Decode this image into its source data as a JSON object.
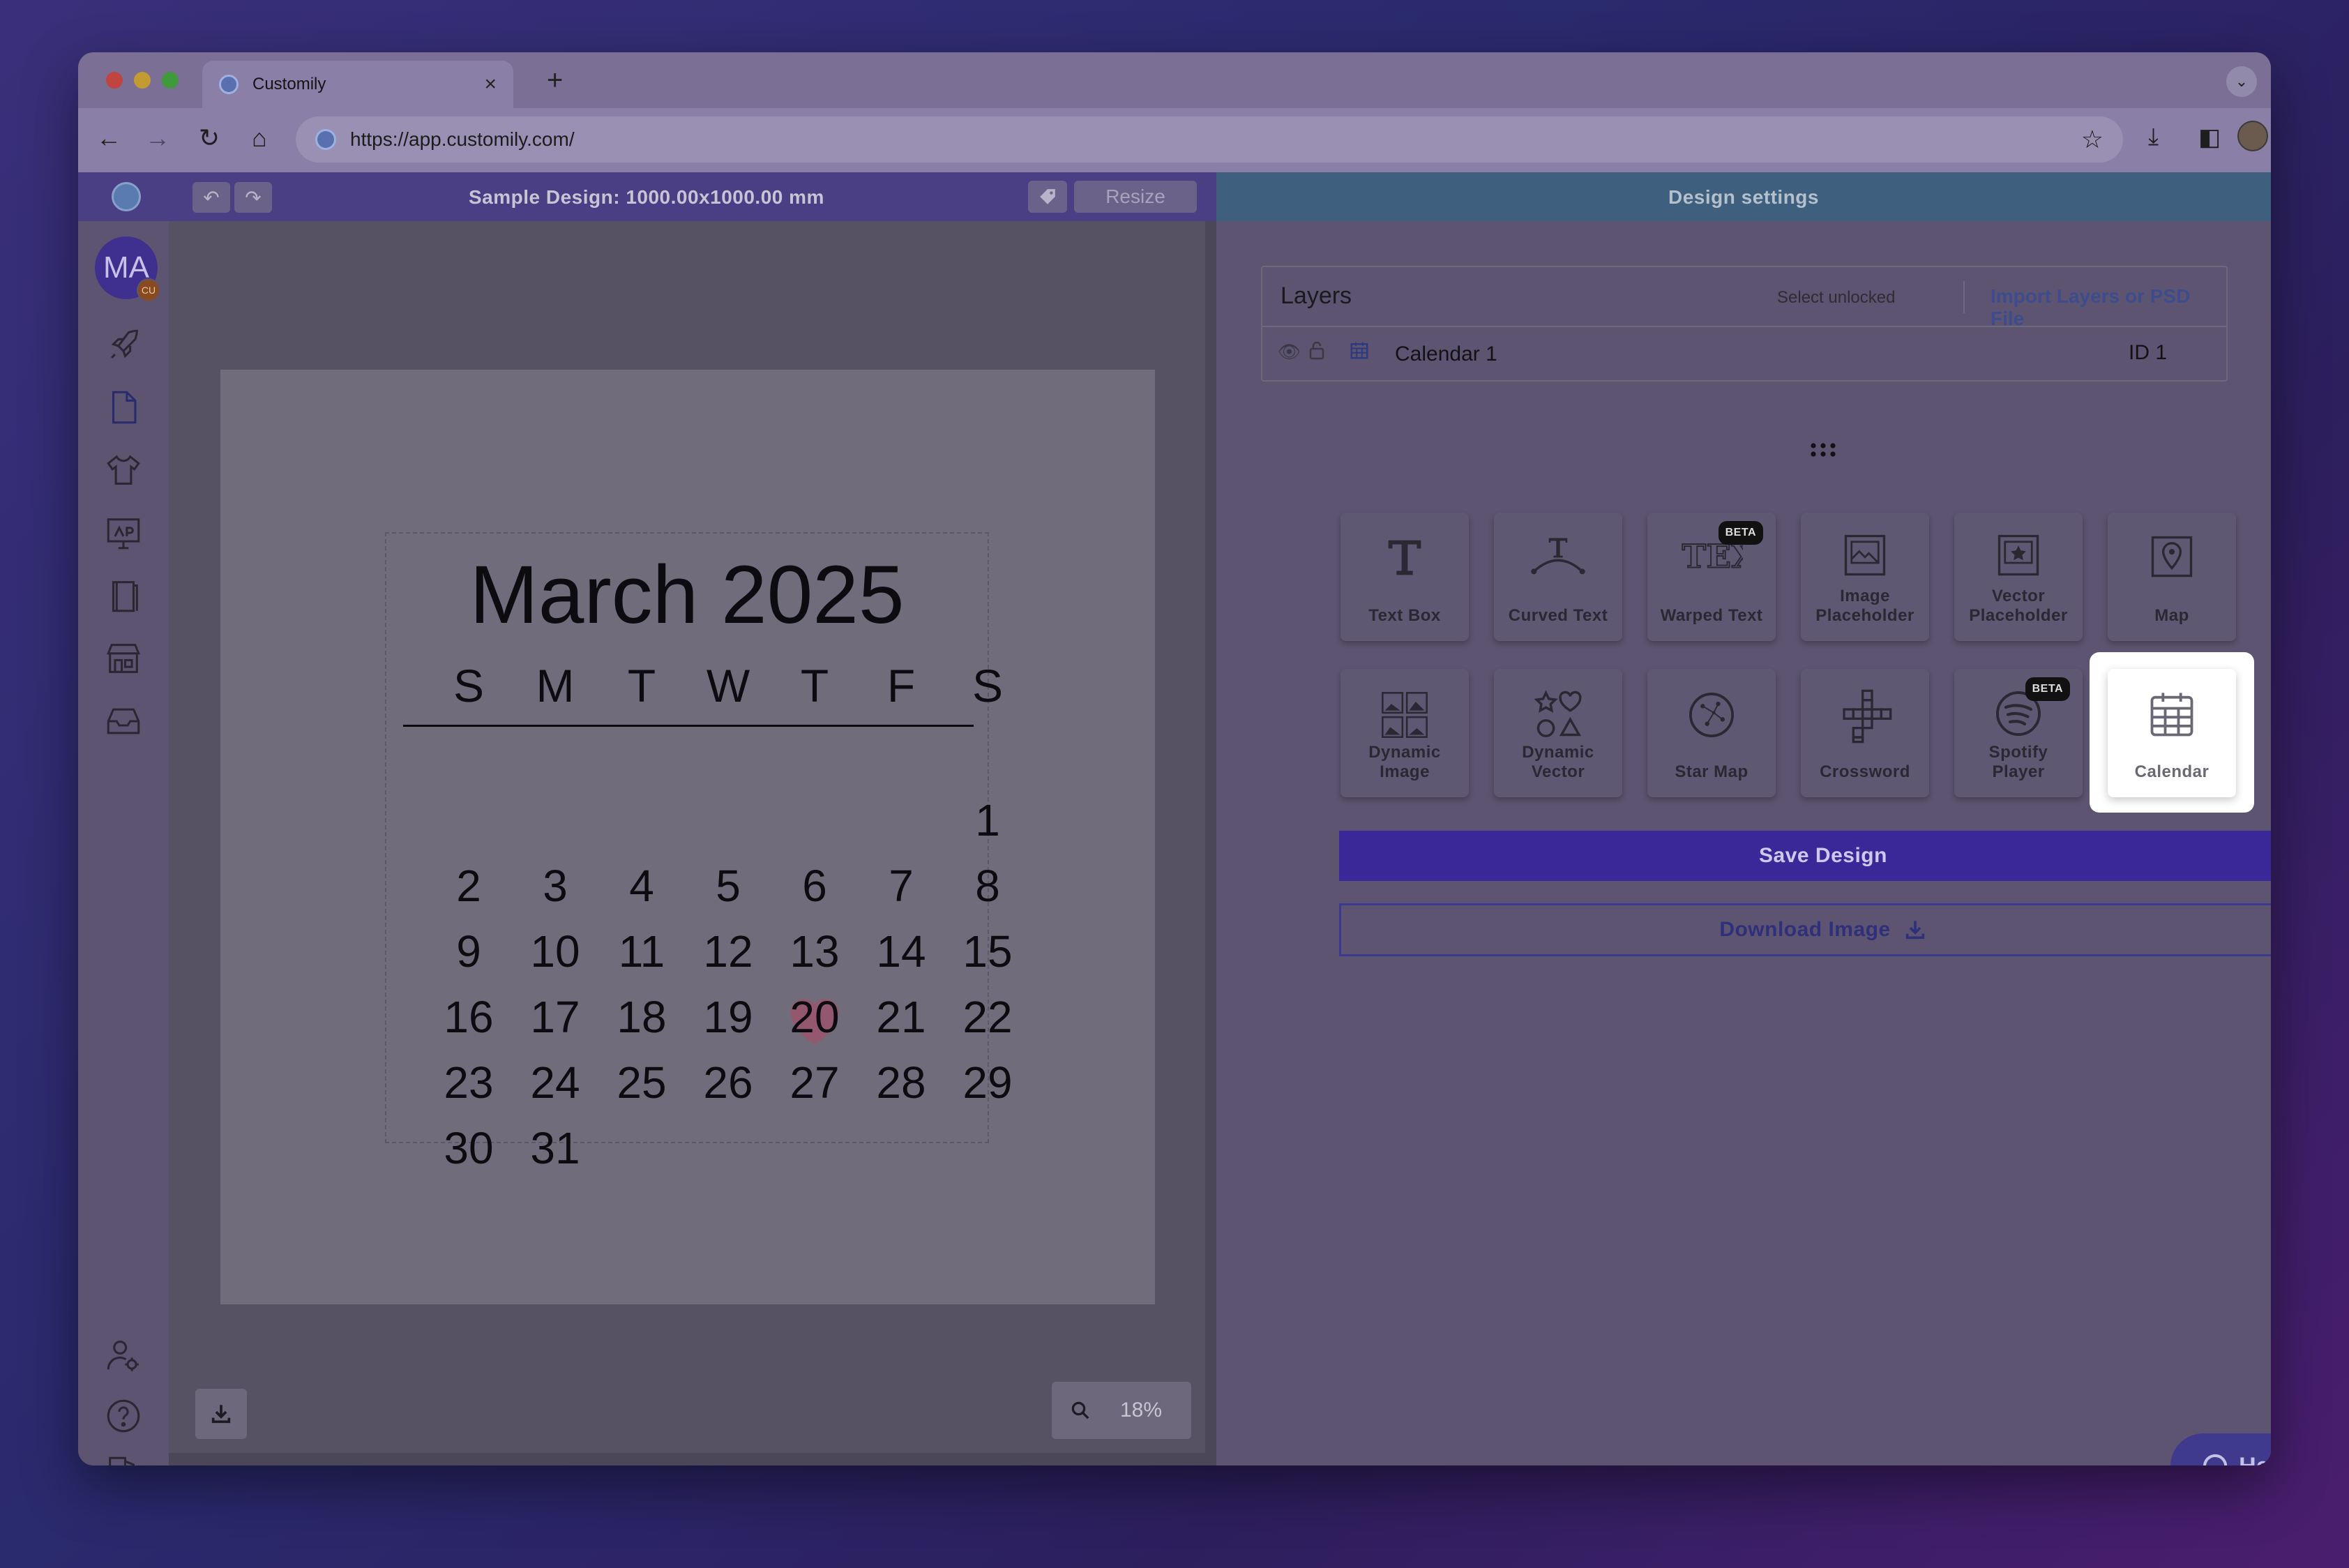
{
  "browser": {
    "tab_title": "Customily",
    "tab_close": "×",
    "new_tab": "+",
    "url": "https://app.customily.com/"
  },
  "app_header": {
    "design_title": "Sample Design: 1000.00x1000.00 mm",
    "resize_label": "Resize",
    "settings_title": "Design settings"
  },
  "sidebar": {
    "avatar_initials": "MA",
    "avatar_badge": "CU",
    "icons": [
      "rocket-icon",
      "document-icon",
      "tshirt-icon",
      "monitor-icon",
      "book-icon",
      "store-icon",
      "inbox-icon",
      "user-settings-icon",
      "help-circle-icon",
      "logout-icon"
    ]
  },
  "calendar": {
    "title": "March 2025",
    "weekdays": [
      "S",
      "M",
      "T",
      "W",
      "T",
      "F",
      "S"
    ],
    "days": [
      "1",
      "2",
      "3",
      "4",
      "5",
      "6",
      "7",
      "8",
      "9",
      "10",
      "11",
      "12",
      "13",
      "14",
      "15",
      "16",
      "17",
      "18",
      "19",
      "20",
      "21",
      "22",
      "23",
      "24",
      "25",
      "26",
      "27",
      "28",
      "29",
      "30",
      "31"
    ],
    "first_weekday_index": 6,
    "highlighted_day": "20",
    "highlight_color": "#a0526a"
  },
  "canvas": {
    "zoom": "18%"
  },
  "layers": {
    "title": "Layers",
    "select_unlocked": "Select unlocked",
    "import_link": "Import Layers or PSD File",
    "rows": [
      {
        "name": "Calendar 1",
        "id": "ID 1"
      }
    ]
  },
  "tools": [
    {
      "label": "Text Box",
      "icon": "text-icon",
      "beta": false
    },
    {
      "label": "Curved Text",
      "icon": "curved-text-icon",
      "beta": false
    },
    {
      "label": "Warped Text",
      "icon": "warped-text-icon",
      "beta": true
    },
    {
      "label": "Image Placeholder",
      "icon": "image-icon",
      "beta": false
    },
    {
      "label": "Vector Placeholder",
      "icon": "vector-icon",
      "beta": false
    },
    {
      "label": "Map",
      "icon": "map-pin-icon",
      "beta": false
    },
    {
      "label": "Dynamic Image",
      "icon": "dynamic-image-icon",
      "beta": false
    },
    {
      "label": "Dynamic Vector",
      "icon": "shapes-icon",
      "beta": false
    },
    {
      "label": "Star Map",
      "icon": "star-map-icon",
      "beta": false
    },
    {
      "label": "Crossword",
      "icon": "crossword-icon",
      "beta": false
    },
    {
      "label": "Spotify Player",
      "icon": "spotify-icon",
      "beta": true
    },
    {
      "label": "Calendar",
      "icon": "calendar-icon",
      "beta": false
    }
  ],
  "beta_label": "BETA",
  "buttons": {
    "save": "Save Design",
    "download": "Download Image",
    "help": "Help"
  },
  "colors": {
    "accent": "#3b2898",
    "header_left": "#4a3e85",
    "header_right": "#3e5f7e"
  }
}
